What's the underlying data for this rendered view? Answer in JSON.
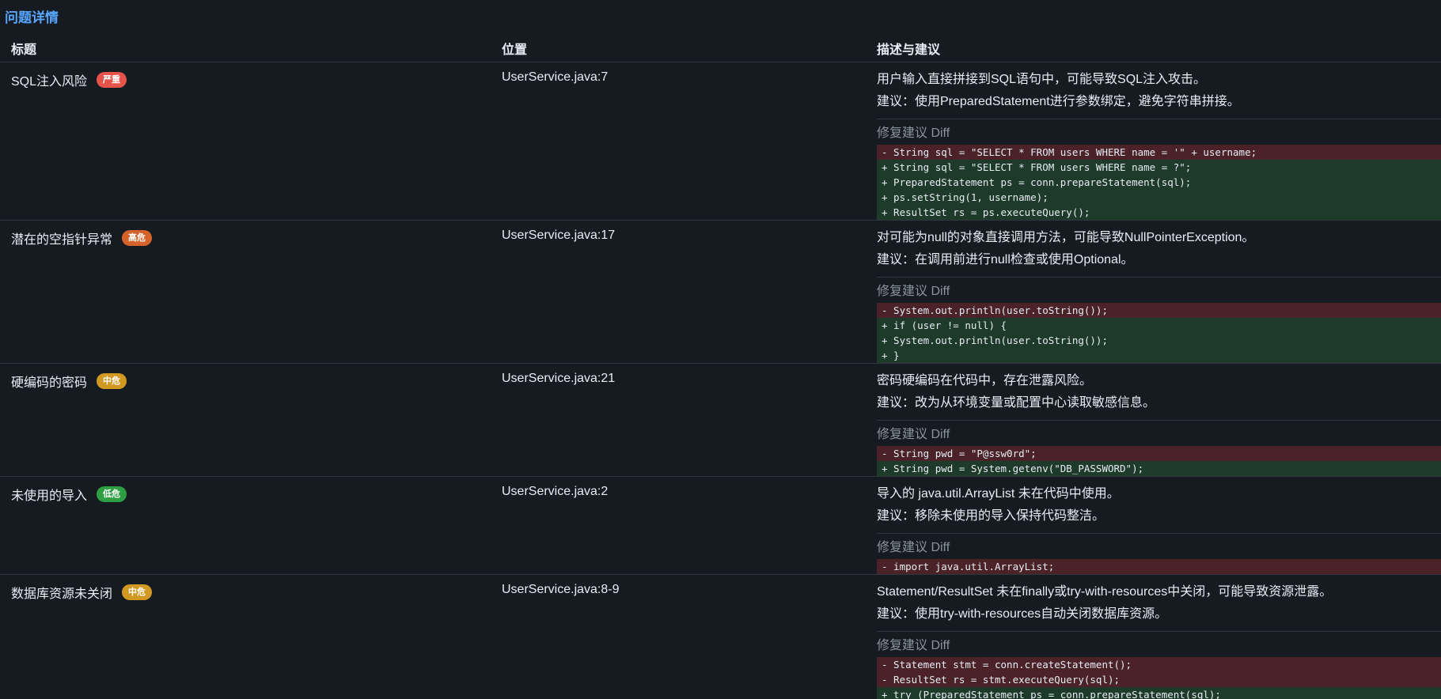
{
  "section_title": "问题详情",
  "columns": {
    "title": "标题",
    "location": "位置",
    "description": "描述与建议"
  },
  "diff_label": "修复建议 Diff",
  "issues": [
    {
      "title": "SQL注入风险",
      "severity": "严重",
      "severity_color": "#e5534b",
      "location": "UserService.java:7",
      "description": "用户输入直接拼接到SQL语句中，可能导致SQL注入攻击。",
      "suggestion": "建议：使用PreparedStatement进行参数绑定，避免字符串拼接。",
      "diff": [
        {
          "type": "del",
          "text": "- String sql = \"SELECT * FROM users WHERE name = '\" + username;"
        },
        {
          "type": "add",
          "text": "+ String sql = \"SELECT * FROM users WHERE name = ?\";"
        },
        {
          "type": "add",
          "text": "+ PreparedStatement ps = conn.prepareStatement(sql);"
        },
        {
          "type": "add",
          "text": "+ ps.setString(1, username);"
        },
        {
          "type": "add",
          "text": "+ ResultSet rs = ps.executeQuery();"
        }
      ]
    },
    {
      "title": "潜在的空指针异常",
      "severity": "高危",
      "severity_color": "#d4622a",
      "location": "UserService.java:17",
      "description": "对可能为null的对象直接调用方法，可能导致NullPointerException。",
      "suggestion": "建议：在调用前进行null检查或使用Optional。",
      "diff": [
        {
          "type": "del",
          "text": "- System.out.println(user.toString());"
        },
        {
          "type": "add",
          "text": "+ if (user != null) {"
        },
        {
          "type": "add",
          "text": "+ System.out.println(user.toString());"
        },
        {
          "type": "add",
          "text": "+ }"
        }
      ]
    },
    {
      "title": "硬编码的密码",
      "severity": "中危",
      "severity_color": "#d29922",
      "location": "UserService.java:21",
      "description": "密码硬编码在代码中，存在泄露风险。",
      "suggestion": "建议：改为从环境变量或配置中心读取敏感信息。",
      "diff": [
        {
          "type": "del",
          "text": "- String pwd = \"P@ssw0rd\";"
        },
        {
          "type": "add",
          "text": "+ String pwd = System.getenv(\"DB_PASSWORD\");"
        }
      ]
    },
    {
      "title": "未使用的导入",
      "severity": "低危",
      "severity_color": "#2ea043",
      "location": "UserService.java:2",
      "description": "导入的 java.util.ArrayList 未在代码中使用。",
      "suggestion": "建议：移除未使用的导入保持代码整洁。",
      "diff": [
        {
          "type": "del",
          "text": "- import java.util.ArrayList;"
        }
      ]
    },
    {
      "title": "数据库资源未关闭",
      "severity": "中危",
      "severity_color": "#d29922",
      "location": "UserService.java:8-9",
      "description": "Statement/ResultSet 未在finally或try-with-resources中关闭，可能导致资源泄露。",
      "suggestion": "建议：使用try-with-resources自动关闭数据库资源。",
      "diff": [
        {
          "type": "del",
          "text": "- Statement stmt = conn.createStatement();"
        },
        {
          "type": "del",
          "text": "- ResultSet rs = stmt.executeQuery(sql);"
        },
        {
          "type": "add",
          "text": "+ try (PreparedStatement ps = conn.prepareStatement(sql);"
        }
      ]
    }
  ]
}
